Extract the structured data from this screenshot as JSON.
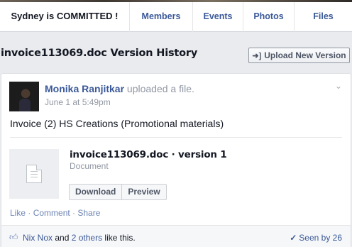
{
  "nav": {
    "group_name": "Sydney is COMMITTED !",
    "tabs": [
      "Members",
      "Events",
      "Photos",
      "Files"
    ]
  },
  "page": {
    "title": "invoice113069.doc Version History",
    "upload_label": "Upload New Version"
  },
  "post": {
    "author": "Monika Ranjitkar",
    "action": "uploaded a file.",
    "timestamp": "June 1 at 5:49pm",
    "message": "Invoice (2) HS Creations (Promotional materials)",
    "file": {
      "name": "invoice113069.doc · version 1",
      "type": "Document",
      "download_label": "Download",
      "preview_label": "Preview"
    },
    "actions": {
      "like": "Like",
      "sep": " · ",
      "comment": "Comment",
      "share": "Share"
    },
    "likes": {
      "first": "Nix Nox",
      "and": " and ",
      "others": "2 others",
      "suffix": " like this."
    },
    "seen": "Seen by 26"
  },
  "icons": {
    "upload": "upload-icon",
    "document": "document-icon",
    "thumbs_up": "thumbs-up-icon",
    "check": "check-icon",
    "chevron": "chevron-down-icon"
  }
}
